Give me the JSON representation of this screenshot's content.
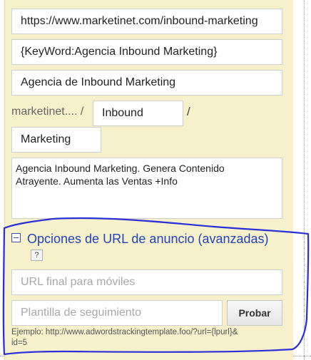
{
  "ad_form": {
    "final_url": "https://www.marketinet.com/inbound-marketing",
    "headline_1": "{KeyWord:Agencia Inbound Marketing}",
    "headline_2": "Agencia de Inbound Marketing",
    "display_domain": "marketinet.... /",
    "path_separator": "/",
    "path_1": "Inbound",
    "path_2": "Marketing",
    "description_line_1": "Agencia Inbound Marketing. Genera Contenido",
    "description_line_2": "Atrayente. Aumenta las Ventas +Info"
  },
  "advanced": {
    "title": "Opciones de URL de anuncio (avanzadas)",
    "help": "?",
    "mobile_url_placeholder": "URL final para móviles",
    "tracking_placeholder": "Plantilla de seguimiento",
    "test_button": "Probar",
    "example_line_1": "Ejemplo: http://www.adwordstrackingtemplate.foo/?url={lpurl}&",
    "example_line_2": "id=5"
  },
  "colors": {
    "panel": "#f6f0cb",
    "link": "#2244bb",
    "annotation": "#2a2fd8"
  }
}
